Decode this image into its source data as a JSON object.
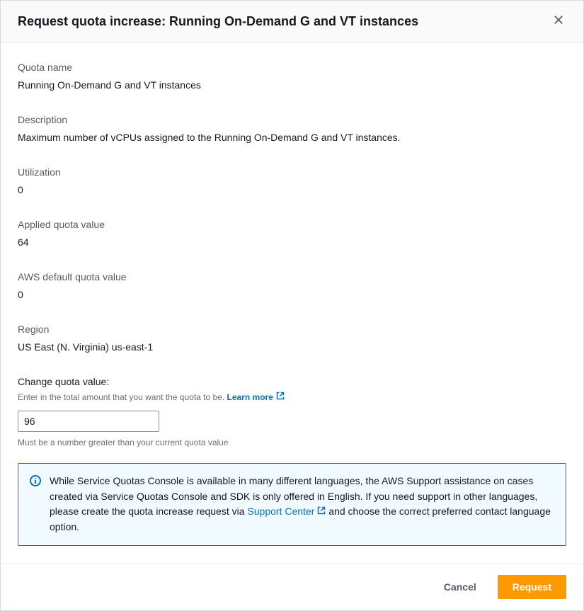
{
  "header": {
    "title": "Request quota increase: Running On-Demand G and VT instances"
  },
  "fields": {
    "quota_name_label": "Quota name",
    "quota_name_value": "Running On-Demand G and VT instances",
    "description_label": "Description",
    "description_value": "Maximum number of vCPUs assigned to the Running On-Demand G and VT instances.",
    "utilization_label": "Utilization",
    "utilization_value": "0",
    "applied_label": "Applied quota value",
    "applied_value": "64",
    "default_label": "AWS default quota value",
    "default_value": "0",
    "region_label": "Region",
    "region_value": "US East (N. Virginia) us-east-1"
  },
  "change": {
    "label": "Change quota value:",
    "hint_prefix": "Enter in the total amount that you want the quota to be. ",
    "learn_more": "Learn more",
    "input_value": "96",
    "input_hint": "Must be a number greater than your current quota value"
  },
  "info": {
    "text_before": "While Service Quotas Console is available in many different languages, the AWS Support assistance on cases created via Service Quotas Console and SDK is only offered in English. If you need support in other languages, please create the quota increase request via ",
    "link_text": "Support Center",
    "text_after": " and choose the correct preferred contact language option."
  },
  "footer": {
    "cancel": "Cancel",
    "request": "Request"
  }
}
